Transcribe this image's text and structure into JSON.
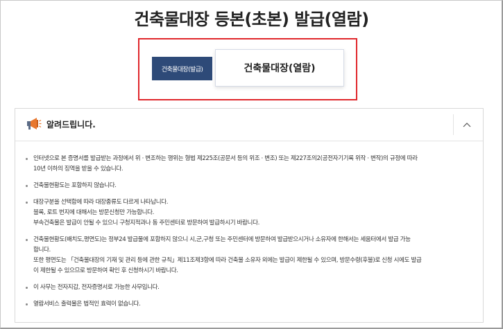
{
  "page": {
    "title": "건축물대장 등본(초본) 발급(열람)"
  },
  "buttons": {
    "issue_label": "건축물대장(발급)",
    "view_label": "건축물대장(열람)"
  },
  "notice": {
    "title": "알려드립니다.",
    "items": [
      {
        "lines": [
          "인터넷으로 본 증명서를 발급받는 과정에서 위 · 변조하는 행위는 형법 제225조(공문서 등의 위조 · 변조) 또는 제227조의2(공전자기기록 위작 · 변작)의 규정에 따라",
          "10년 이하의 징역을 받을 수 있습니다."
        ]
      },
      {
        "lines": [
          "건축물현황도는 포함하지 않습니다."
        ]
      },
      {
        "lines": [
          "대장구분을 선택함에 따라 대장종류도 다르게 나타납니다.",
          "블록, 로트 번지에 대해서는 방문신청만 가능합니다.",
          "부속건축물은 발급이 안될 수 있으니 구청지적과나 동 주민센터로 방문하여 발급하시기 바랍니다."
        ]
      },
      {
        "lines": [
          "건축물현황도(배치도,평면도)는 정부24 발급물에 포함하지 않으니 시,군,구청 또는 주민센터에 방문하여 발급받으시거나 소유자에 한해서는 세움터에서 발급 가능",
          "합니다.",
          "또한 평면도는 「건축물대장의 기재 및 관리 등에 관한 규칙」제11조제3항에 따라 건축물 소유자 외에는 발급이 제한될 수 있으며, 방문수령(후불)로 신청 시에도 발급",
          "이 제한될 수 있으므로 방문하여 확인 후 신청하시기 바랍니다."
        ]
      },
      {
        "lines": [
          "이 사무는 전자지갑, 전자증명서로 가능한 사무입니다."
        ]
      },
      {
        "lines": [
          "열람서비스 출력물은 법적인 효력이 없습니다."
        ]
      }
    ]
  },
  "icons": {
    "notice": "megaphone-icon",
    "toggle": "chevron-up-icon"
  },
  "colors": {
    "accent_red": "#e0262b",
    "button_navy": "#2e4a78",
    "megaphone_orange": "#e8772e"
  }
}
